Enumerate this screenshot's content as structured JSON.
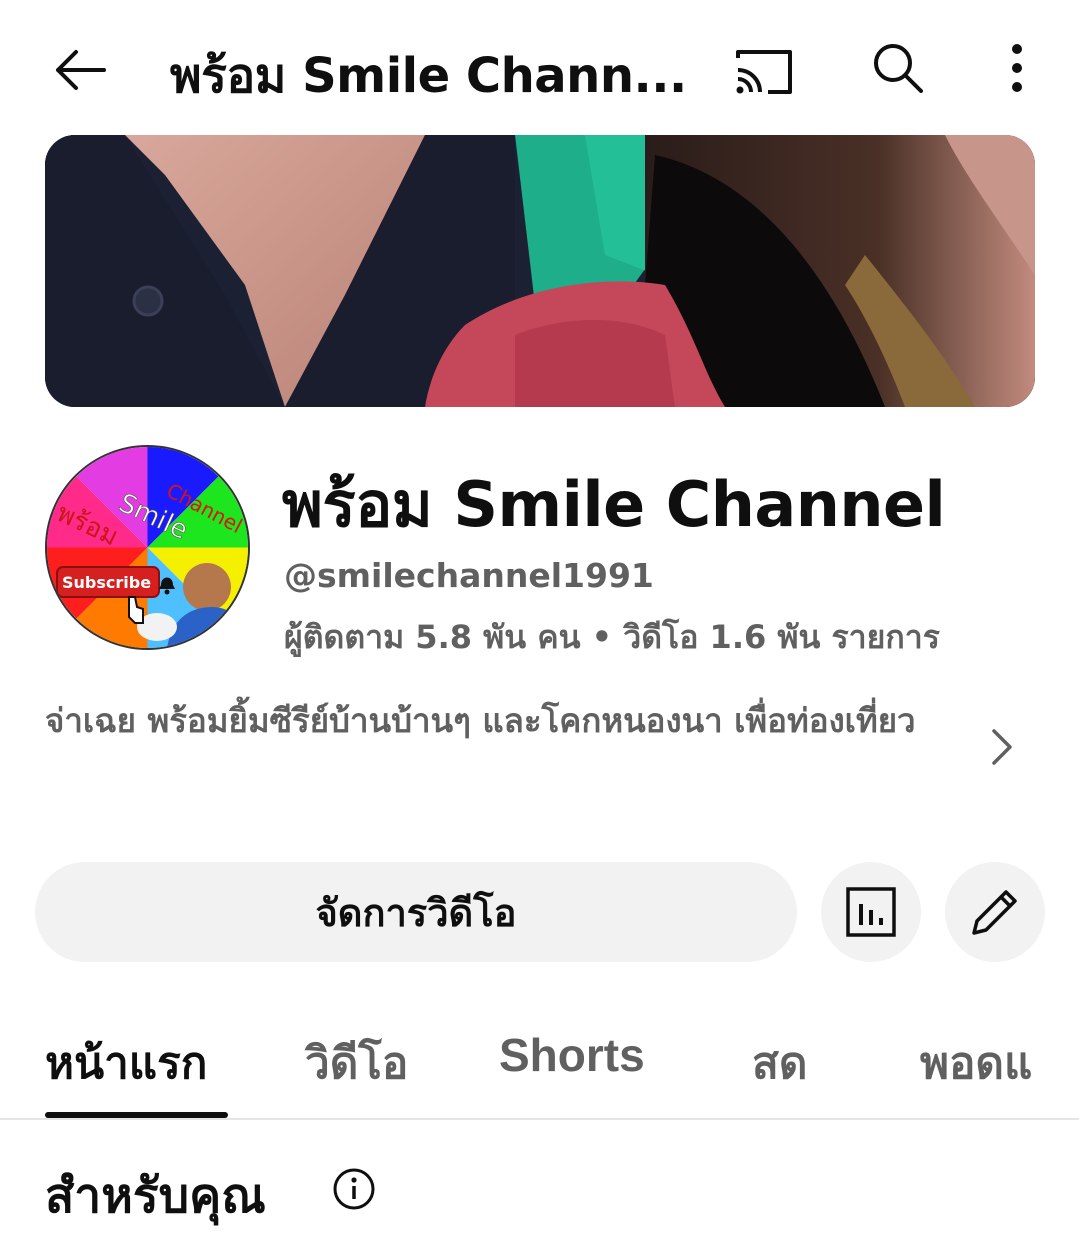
{
  "topbar": {
    "title": "พร้อม Smile Chann...",
    "icons": [
      "back-arrow-icon",
      "cast-icon",
      "search-icon",
      "more-vert-icon"
    ]
  },
  "channel": {
    "name": "พร้อม Smile Channel",
    "handle": "@smilechannel1991",
    "stats": "ผู้ติดตาม 5.8 พัน คน • วิดีโอ 1.6 พัน รายการ",
    "description": "จ่าเฉย พร้อมยิ้มซีรีย์บ้านบ้านๆ  และโคกหนองนา เพื่อท่องเที่ยว",
    "avatar": {
      "text_channel": "Channel",
      "text_smile": "Smile",
      "text_thai": "พร้อม",
      "subscribe": "Subscribe"
    }
  },
  "actions": {
    "manage_label": "จัดการวิดีโอ",
    "icons": [
      "analytics-icon",
      "edit-pencil-icon"
    ]
  },
  "tabs": [
    {
      "label": "หน้าแรก",
      "active": true
    },
    {
      "label": "วิดีโอ",
      "active": false
    },
    {
      "label": "Shorts",
      "active": false
    },
    {
      "label": "สด",
      "active": false
    },
    {
      "label": "พอดแ",
      "active": false
    }
  ],
  "section": {
    "title": "สำหรับคุณ"
  },
  "colors": {
    "text_primary": "#0f0f0f",
    "text_secondary": "#606060",
    "button_bg": "#f2f2f2",
    "subscribe_red": "#d61f1f"
  }
}
